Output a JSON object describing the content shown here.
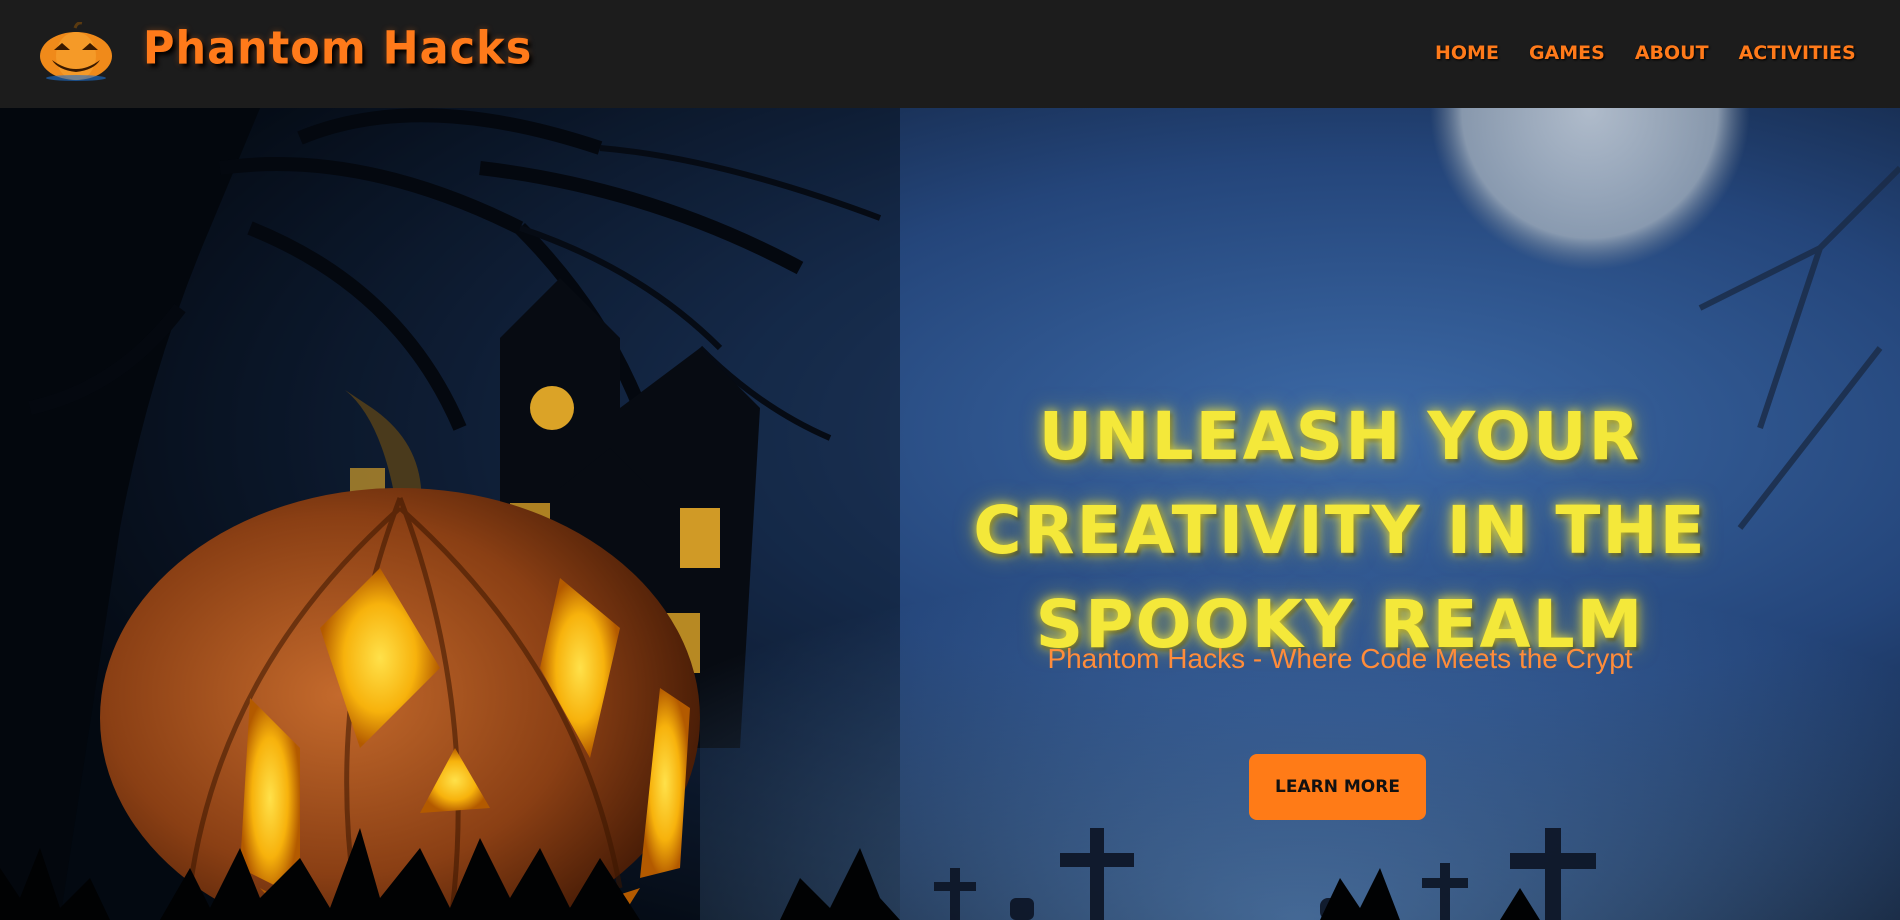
{
  "header": {
    "logo_icon": "jack-o-lantern-icon",
    "brand": "Phantom Hacks",
    "nav": [
      {
        "label": "Home"
      },
      {
        "label": "Games"
      },
      {
        "label": "About"
      },
      {
        "label": "Activities"
      }
    ]
  },
  "hero": {
    "title": "Unleash Your Creativity in the Spooky Realm",
    "subtitle": "Phantom Hacks - Where Code Meets the Crypt",
    "cta_label": "Learn More",
    "background_image": "haunted-night-scene-with-jack-o-lantern"
  },
  "colors": {
    "header_bg": "#1c1c1c",
    "accent_orange": "#ff7b17",
    "title_yellow": "#f4e83a",
    "subtitle_orange": "#ff8c3a",
    "night_blue": "#2a4f82"
  }
}
